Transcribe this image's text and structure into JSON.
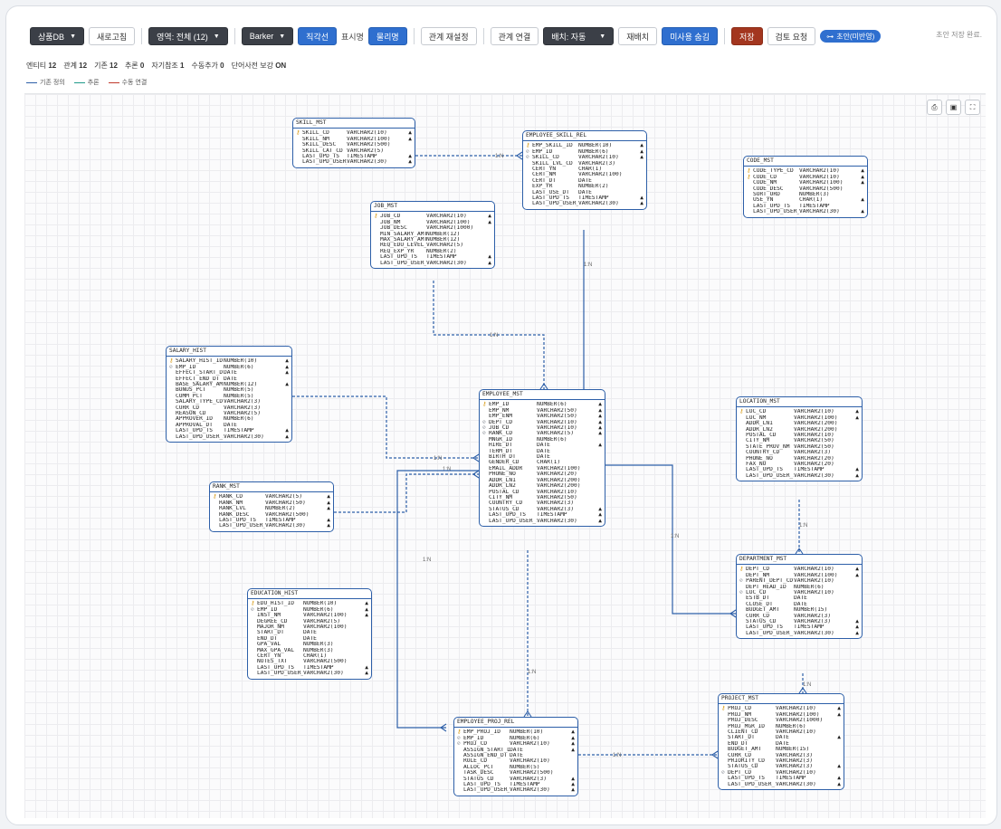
{
  "toolbar": {
    "db": "상품DB",
    "new": "새로고침",
    "area": "영역: 전체 (12)",
    "style": "Barker",
    "orth": "직각선",
    "display_label": "표시명",
    "display_value": "물리명",
    "rel_reset": "관계 재설정",
    "rel_link": "관계 연결",
    "layout": "배치: 자동",
    "relayout": "재배치",
    "hide_unused": "미사용 숨김",
    "save": "저장",
    "review": "검토 요청",
    "draft": "초안(미반영)",
    "autosave": "초안 저장 완료."
  },
  "stats": [
    {
      "label": "엔티티",
      "value": "12"
    },
    {
      "label": "관계",
      "value": "12"
    },
    {
      "label": "기존",
      "value": "12"
    },
    {
      "label": "추론",
      "value": "0"
    },
    {
      "label": "자기참조",
      "value": "1"
    },
    {
      "label": "수동추가",
      "value": "0"
    },
    {
      "label": "단어사전 보강",
      "value": "ON"
    }
  ],
  "legend": [
    {
      "label": "기존 정의",
      "color": "#2d5fa8"
    },
    {
      "label": "추론",
      "color": "#1f9a8a"
    },
    {
      "label": "수동 연결",
      "color": "#c0392b"
    }
  ],
  "canvas_buttons": [
    "print-icon",
    "save-icon",
    "fullscreen-icon"
  ],
  "rel_label": "1:N",
  "entities": [
    {
      "id": "SKILL_MST",
      "name": "SKILL_MST",
      "rows": [
        [
          "pk",
          "SKILL_CD",
          "VARCHAR2(10)",
          "▲"
        ],
        [
          "",
          "SKILL_NM",
          "VARCHAR2(100)",
          "▲"
        ],
        [
          "",
          "SKILL_DESC",
          "VARCHAR2(500)",
          ""
        ],
        [
          "",
          "SKILL_CAT_CD",
          "VARCHAR2(5)",
          ""
        ],
        [
          "",
          "LAST_UPD_TS",
          "TIMESTAMP",
          "▲"
        ],
        [
          "",
          "LAST_UPD_USER_ID",
          "VARCHAR2(30)",
          "▲"
        ]
      ]
    },
    {
      "id": "EMPLOYEE_SKILL_REL",
      "name": "EMPLOYEE_SKILL_REL",
      "rows": [
        [
          "pk",
          "EMP_SKILL_ID",
          "NUMBER(10)",
          "▲"
        ],
        [
          "fk",
          "EMP_ID",
          "NUMBER(6)",
          "▲"
        ],
        [
          "fk",
          "SKILL_CD",
          "VARCHAR2(10)",
          "▲"
        ],
        [
          "",
          "SKILL_LVL_CD",
          "VARCHAR2(3)",
          ""
        ],
        [
          "",
          "CERT_YN",
          "CHAR(1)",
          ""
        ],
        [
          "",
          "CERT_NM",
          "VARCHAR2(100)",
          ""
        ],
        [
          "",
          "CERT_DT",
          "DATE",
          ""
        ],
        [
          "",
          "EXP_YR",
          "NUMBER(2)",
          ""
        ],
        [
          "",
          "LAST_USE_DT",
          "DATE",
          ""
        ],
        [
          "",
          "LAST_UPD_TS",
          "TIMESTAMP",
          "▲"
        ],
        [
          "",
          "LAST_UPD_USER_ID",
          "VARCHAR2(30)",
          "▲"
        ]
      ]
    },
    {
      "id": "CODE_MST",
      "name": "CODE_MST",
      "rows": [
        [
          "pk",
          "CODE_TYPE_CD",
          "VARCHAR2(10)",
          "▲"
        ],
        [
          "pk",
          "CODE_CD",
          "VARCHAR2(10)",
          "▲"
        ],
        [
          "",
          "CODE_NM",
          "VARCHAR2(100)",
          "▲"
        ],
        [
          "",
          "CODE_DESC",
          "VARCHAR2(500)",
          ""
        ],
        [
          "",
          "SORT_ORD",
          "NUMBER(3)",
          ""
        ],
        [
          "",
          "USE_YN",
          "CHAR(1)",
          "▲"
        ],
        [
          "",
          "LAST_UPD_TS",
          "TIMESTAMP",
          ""
        ],
        [
          "",
          "LAST_UPD_USER_ID",
          "VARCHAR2(30)",
          "▲"
        ]
      ]
    },
    {
      "id": "JOB_MST",
      "name": "JOB_MST",
      "rows": [
        [
          "pk",
          "JOB_CD",
          "VARCHAR2(10)",
          "▲"
        ],
        [
          "",
          "JOB_NM",
          "VARCHAR2(100)",
          "▲"
        ],
        [
          "",
          "JOB_DESC",
          "VARCHAR2(1000)",
          ""
        ],
        [
          "",
          "MIN_SALARY_AMT",
          "NUMBER(12)",
          ""
        ],
        [
          "",
          "MAX_SALARY_AMT",
          "NUMBER(12)",
          ""
        ],
        [
          "",
          "REQ_EDU_LEVEL_CD",
          "VARCHAR2(5)",
          ""
        ],
        [
          "",
          "REQ_EXP_YR",
          "NUMBER(2)",
          ""
        ],
        [
          "",
          "LAST_UPD_TS",
          "TIMESTAMP",
          "▲"
        ],
        [
          "",
          "LAST_UPD_USER_ID",
          "VARCHAR2(30)",
          "▲"
        ]
      ]
    },
    {
      "id": "SALARY_HIST",
      "name": "SALARY_HIST",
      "rows": [
        [
          "pk",
          "SALARY_HIST_ID",
          "NUMBER(10)",
          "▲"
        ],
        [
          "fk",
          "EMP_ID",
          "NUMBER(6)",
          "▲"
        ],
        [
          "",
          "EFFECT_START_DT",
          "DATE",
          "▲"
        ],
        [
          "",
          "EFFECT_END_DT",
          "DATE",
          ""
        ],
        [
          "",
          "BASE_SALARY_AMT",
          "NUMBER(12)",
          "▲"
        ],
        [
          "",
          "BONUS_PCT",
          "NUMBER(5)",
          ""
        ],
        [
          "",
          "COMM_PCT",
          "NUMBER(5)",
          ""
        ],
        [
          "",
          "SALARY_TYPE_CD",
          "VARCHAR2(3)",
          ""
        ],
        [
          "",
          "CURR_CD",
          "VARCHAR2(3)",
          ""
        ],
        [
          "",
          "REASON_CD",
          "VARCHAR2(5)",
          ""
        ],
        [
          "",
          "APPROVER_ID",
          "NUMBER(6)",
          ""
        ],
        [
          "",
          "APPROVAL_DT",
          "DATE",
          ""
        ],
        [
          "",
          "LAST_UPD_TS",
          "TIMESTAMP",
          "▲"
        ],
        [
          "",
          "LAST_UPD_USER_ID",
          "VARCHAR2(30)",
          "▲"
        ]
      ]
    },
    {
      "id": "EMPLOYEE_MST",
      "name": "EMPLOYEE_MST",
      "rows": [
        [
          "pk",
          "EMP_ID",
          "NUMBER(6)",
          "▲"
        ],
        [
          "",
          "EMP_NM",
          "VARCHAR2(50)",
          "▲"
        ],
        [
          "",
          "EMP_ENM",
          "VARCHAR2(50)",
          "▲"
        ],
        [
          "fk",
          "DEPT_CD",
          "VARCHAR2(10)",
          "▲"
        ],
        [
          "fk",
          "JOB_CD",
          "VARCHAR2(10)",
          "▲"
        ],
        [
          "fk",
          "RANK_CD",
          "VARCHAR2(5)",
          "▲"
        ],
        [
          "",
          "MNGR_ID",
          "NUMBER(6)",
          ""
        ],
        [
          "",
          "HIRE_DT",
          "DATE",
          "▲"
        ],
        [
          "",
          "TERM_DT",
          "DATE",
          ""
        ],
        [
          "",
          "BIRTH_DT",
          "DATE",
          ""
        ],
        [
          "",
          "GENDER_CD",
          "CHAR(1)",
          ""
        ],
        [
          "",
          "EMAIL_ADDR",
          "VARCHAR2(100)",
          ""
        ],
        [
          "",
          "PHONE_NO",
          "VARCHAR2(20)",
          ""
        ],
        [
          "",
          "ADDR_LN1",
          "VARCHAR2(200)",
          ""
        ],
        [
          "",
          "ADDR_LN2",
          "VARCHAR2(200)",
          ""
        ],
        [
          "",
          "POSTAL_CD",
          "VARCHAR2(10)",
          ""
        ],
        [
          "",
          "CITY_NM",
          "VARCHAR2(50)",
          ""
        ],
        [
          "",
          "COUNTRY_CD",
          "VARCHAR2(3)",
          ""
        ],
        [
          "",
          "STATUS_CD",
          "VARCHAR2(3)",
          "▲"
        ],
        [
          "",
          "LAST_UPD_TS",
          "TIMESTAMP",
          "▲"
        ],
        [
          "",
          "LAST_UPD_USER_ID",
          "VARCHAR2(30)",
          "▲"
        ]
      ]
    },
    {
      "id": "LOCATION_MST",
      "name": "LOCATION_MST",
      "rows": [
        [
          "pk",
          "LOC_CD",
          "VARCHAR2(10)",
          "▲"
        ],
        [
          "",
          "LOC_NM",
          "VARCHAR2(100)",
          "▲"
        ],
        [
          "",
          "ADDR_LN1",
          "VARCHAR2(200)",
          ""
        ],
        [
          "",
          "ADDR_LN2",
          "VARCHAR2(200)",
          ""
        ],
        [
          "",
          "POSTAL_CD",
          "VARCHAR2(10)",
          ""
        ],
        [
          "",
          "CITY_NM",
          "VARCHAR2(50)",
          ""
        ],
        [
          "",
          "STATE_PROV_NM",
          "VARCHAR2(50)",
          ""
        ],
        [
          "",
          "COUNTRY_CD",
          "VARCHAR2(3)",
          ""
        ],
        [
          "",
          "PHONE_NO",
          "VARCHAR2(20)",
          ""
        ],
        [
          "",
          "FAX_NO",
          "VARCHAR2(20)",
          ""
        ],
        [
          "",
          "LAST_UPD_TS",
          "TIMESTAMP",
          "▲"
        ],
        [
          "",
          "LAST_UPD_USER_ID",
          "VARCHAR2(30)",
          "▲"
        ]
      ]
    },
    {
      "id": "RANK_MST",
      "name": "RANK_MST",
      "rows": [
        [
          "pk",
          "RANK_CD",
          "VARCHAR2(5)",
          "▲"
        ],
        [
          "",
          "RANK_NM",
          "VARCHAR2(50)",
          "▲"
        ],
        [
          "",
          "RANK_LVL",
          "NUMBER(2)",
          "▲"
        ],
        [
          "",
          "RANK_DESC",
          "VARCHAR2(500)",
          ""
        ],
        [
          "",
          "LAST_UPD_TS",
          "TIMESTAMP",
          "▲"
        ],
        [
          "",
          "LAST_UPD_USER_ID",
          "VARCHAR2(30)",
          "▲"
        ]
      ]
    },
    {
      "id": "DEPARTMENT_MST",
      "name": "DEPARTMENT_MST",
      "rows": [
        [
          "pk",
          "DEPT_CD",
          "VARCHAR2(10)",
          "▲"
        ],
        [
          "",
          "DEPT_NM",
          "VARCHAR2(100)",
          "▲"
        ],
        [
          "fk",
          "PARENT_DEPT_CD",
          "VARCHAR2(10)",
          ""
        ],
        [
          "",
          "DEPT_HEAD_ID",
          "NUMBER(6)",
          ""
        ],
        [
          "fk",
          "LOC_CD",
          "VARCHAR2(10)",
          ""
        ],
        [
          "",
          "ESTB_DT",
          "DATE",
          ""
        ],
        [
          "",
          "CLOSE_DT",
          "DATE",
          ""
        ],
        [
          "",
          "BUDGET_AMT",
          "NUMBER(15)",
          ""
        ],
        [
          "",
          "CURR_CD",
          "VARCHAR2(3)",
          ""
        ],
        [
          "",
          "STATUS_CD",
          "VARCHAR2(3)",
          "▲"
        ],
        [
          "",
          "LAST_UPD_TS",
          "TIMESTAMP",
          "▲"
        ],
        [
          "",
          "LAST_UPD_USER_ID",
          "VARCHAR2(30)",
          "▲"
        ]
      ]
    },
    {
      "id": "EDUCATION_HIST",
      "name": "EDUCATION_HIST",
      "rows": [
        [
          "pk",
          "EDU_HIST_ID",
          "NUMBER(10)",
          "▲"
        ],
        [
          "fk",
          "EMP_ID",
          "NUMBER(6)",
          "▲"
        ],
        [
          "",
          "INST_NM",
          "VARCHAR2(100)",
          "▲"
        ],
        [
          "",
          "DEGREE_CD",
          "VARCHAR2(5)",
          ""
        ],
        [
          "",
          "MAJOR_NM",
          "VARCHAR2(100)",
          ""
        ],
        [
          "",
          "START_DT",
          "DATE",
          ""
        ],
        [
          "",
          "END_DT",
          "DATE",
          ""
        ],
        [
          "",
          "GPA_VAL",
          "NUMBER(3)",
          ""
        ],
        [
          "",
          "MAX_GPA_VAL",
          "NUMBER(3)",
          ""
        ],
        [
          "",
          "CERT_YN",
          "CHAR(1)",
          ""
        ],
        [
          "",
          "NOTES_TXT",
          "VARCHAR2(500)",
          ""
        ],
        [
          "",
          "LAST_UPD_TS",
          "TIMESTAMP",
          "▲"
        ],
        [
          "",
          "LAST_UPD_USER_ID",
          "VARCHAR2(30)",
          "▲"
        ]
      ]
    },
    {
      "id": "PROJECT_MST",
      "name": "PROJECT_MST",
      "rows": [
        [
          "pk",
          "PROJ_CD",
          "VARCHAR2(10)",
          "▲"
        ],
        [
          "",
          "PROJ_NM",
          "VARCHAR2(100)",
          "▲"
        ],
        [
          "",
          "PROJ_DESC",
          "VARCHAR2(1000)",
          ""
        ],
        [
          "",
          "PROJ_MGR_ID",
          "NUMBER(6)",
          ""
        ],
        [
          "",
          "CLIENT_CD",
          "VARCHAR2(10)",
          ""
        ],
        [
          "",
          "START_DT",
          "DATE",
          "▲"
        ],
        [
          "",
          "END_DT",
          "DATE",
          ""
        ],
        [
          "",
          "BUDGET_AMT",
          "NUMBER(15)",
          ""
        ],
        [
          "",
          "CURR_CD",
          "VARCHAR2(3)",
          ""
        ],
        [
          "",
          "PRIORITY_CD",
          "VARCHAR2(3)",
          ""
        ],
        [
          "",
          "STATUS_CD",
          "VARCHAR2(3)",
          "▲"
        ],
        [
          "fk",
          "DEPT_CD",
          "VARCHAR2(10)",
          ""
        ],
        [
          "",
          "LAST_UPD_TS",
          "TIMESTAMP",
          "▲"
        ],
        [
          "",
          "LAST_UPD_USER_ID",
          "VARCHAR2(30)",
          "▲"
        ]
      ]
    },
    {
      "id": "EMPLOYEE_PROJ_REL",
      "name": "EMPLOYEE_PROJ_REL",
      "rows": [
        [
          "pk",
          "EMP_PROJ_ID",
          "NUMBER(10)",
          "▲"
        ],
        [
          "fk",
          "EMP_ID",
          "NUMBER(6)",
          "▲"
        ],
        [
          "fk",
          "PROJ_CD",
          "VARCHAR2(10)",
          "▲"
        ],
        [
          "",
          "ASSIGN_START_DT",
          "DATE",
          "▲"
        ],
        [
          "",
          "ASSIGN_END_DT",
          "DATE",
          ""
        ],
        [
          "",
          "ROLE_CD",
          "VARCHAR2(10)",
          ""
        ],
        [
          "",
          "ALLOC_PCT",
          "NUMBER(5)",
          ""
        ],
        [
          "",
          "TASK_DESC",
          "VARCHAR2(500)",
          ""
        ],
        [
          "",
          "STATUS_CD",
          "VARCHAR2(3)",
          "▲"
        ],
        [
          "",
          "LAST_UPD_TS",
          "TIMESTAMP",
          "▲"
        ],
        [
          "",
          "LAST_UPD_USER_ID",
          "VARCHAR2(30)",
          "▲"
        ]
      ]
    }
  ]
}
